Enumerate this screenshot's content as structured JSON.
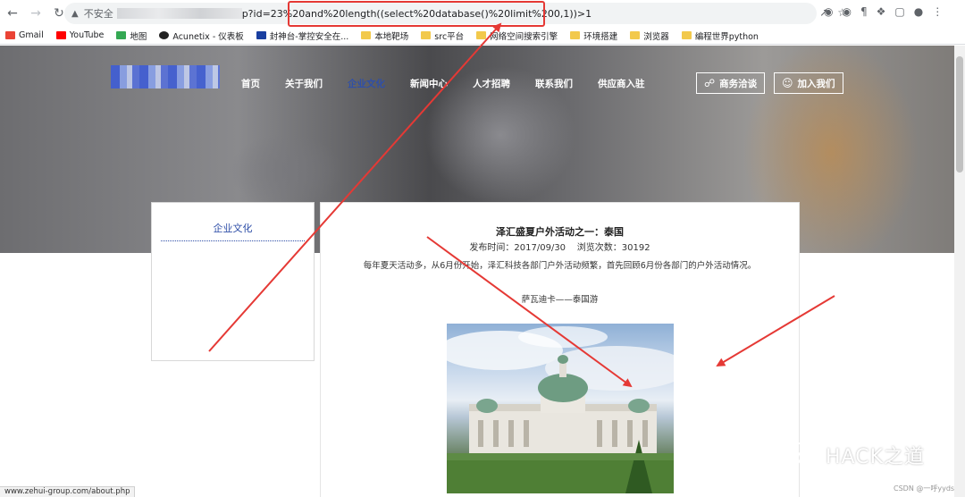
{
  "browser": {
    "insecure_label": "不安全",
    "url_visible_start": "p?id=23",
    "url_highlight": "%20and%20length((select%20database()%20limit%200,1))>1",
    "bookmarks": [
      {
        "label": "Gmail",
        "color": "#ea4335"
      },
      {
        "label": "YouTube",
        "color": "#ff0000"
      },
      {
        "label": "地图",
        "color": "#34a853"
      },
      {
        "label": "Acunetix - 仪表板",
        "color": "#222222"
      },
      {
        "label": "封神台-掌控安全在...",
        "color": "#1a3fa0"
      },
      {
        "label": "本地靶场",
        "color": "#f2c94c"
      },
      {
        "label": "src平台",
        "color": "#f2c94c"
      },
      {
        "label": "网络空间搜索引擎",
        "color": "#f2c94c"
      },
      {
        "label": "环境搭建",
        "color": "#f2c94c"
      },
      {
        "label": "浏览器",
        "color": "#f2c94c"
      },
      {
        "label": "编程世界python",
        "color": "#f2c94c"
      }
    ],
    "status_url": "www.zehui-group.com/about.php"
  },
  "site": {
    "nav": [
      "首页",
      "关于我们",
      "企业文化",
      "新闻中心",
      "人才招聘",
      "联系我们",
      "供应商入驻"
    ],
    "active_nav": "企业文化",
    "btn_business": "商务洽谈",
    "btn_join": "加入我们"
  },
  "sidebar": {
    "title": "企业文化"
  },
  "article": {
    "title": "泽汇盛夏户外活动之一：泰国",
    "meta": "发布时间：2017/09/30    浏览次数：30192",
    "intro": "每年夏天活动多，从6月份开始，泽汇科技各部门户外活动频繁，首先回顾6月份各部门的户外活动情况。",
    "subtitle": "萨瓦迪卡——泰国游"
  },
  "watermark": {
    "text": "HACK之道",
    "csdn": "CSDN @一呼yyds"
  },
  "colors": {
    "accent": "#2f4fa8",
    "annotation_red": "#e53935"
  }
}
